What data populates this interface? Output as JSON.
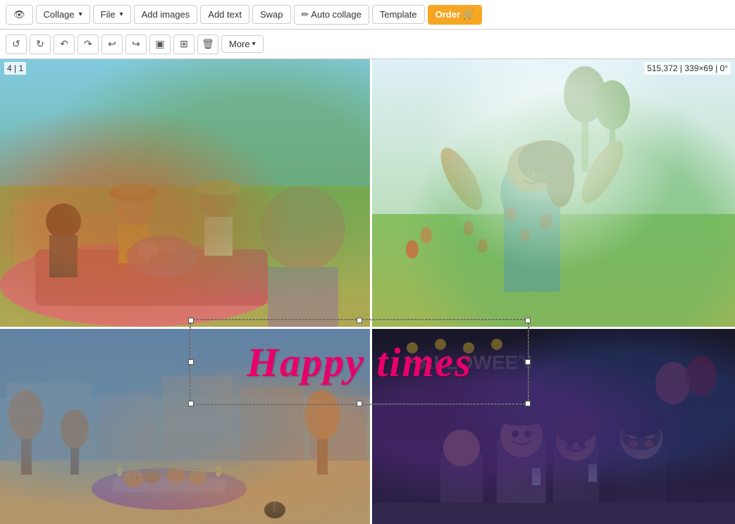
{
  "topToolbar": {
    "eyeBtn": "👁",
    "collageBtn": "Collage",
    "fileBtn": "File",
    "addImagesBtn": "Add images",
    "addTextBtn": "Add text",
    "swapBtn": "Swap",
    "autoCollageBtn": "✏ Auto collage",
    "templateBtn": "Template",
    "orderBtn": "Order 🛒"
  },
  "secondaryToolbar": {
    "moreBtn": "More"
  },
  "canvasInfo": {
    "topLeft": "4 | 1",
    "topRight": "515,372 | 339×69 | 0°"
  },
  "textOverlay": {
    "text": "Happy times"
  }
}
